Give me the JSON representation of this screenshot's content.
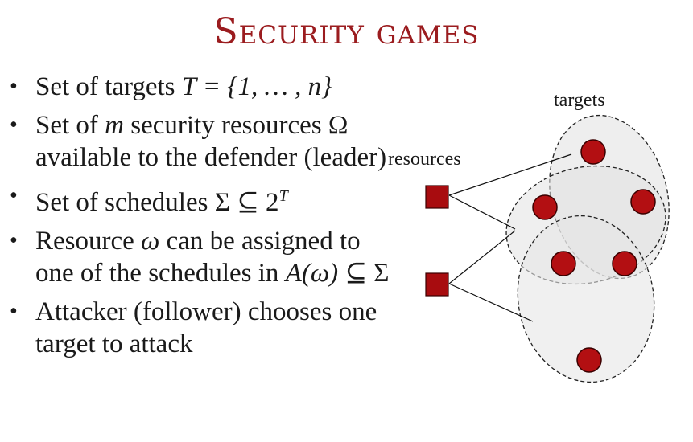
{
  "title": "Security games",
  "bullets": [
    {
      "pre": "Set of targets ",
      "math": "T = {1, … , n}"
    },
    {
      "pre": "Set of ",
      "math": "m",
      "post": " security resources Ω available to the defender (leader)"
    },
    {
      "pre": "Set of schedules Σ ⊆ 2",
      "sup": "T"
    },
    {
      "pre": "Resource ",
      "math": "ω",
      "post": " can be assigned to one of the schedules in ",
      "math2": "A(ω)",
      "post2": " ⊆ Σ"
    },
    {
      "pre": "Attacker (follower) chooses one target to attack"
    }
  ],
  "diagram": {
    "targets_label": "targets",
    "resources_label": "resources",
    "colors": {
      "node_fill": "#b30f12",
      "node_stroke": "#3a0000",
      "ellipse_fill": "#e9e9e9",
      "resource_fill": "#a80c0f",
      "title_color": "#9b1c1f"
    }
  }
}
